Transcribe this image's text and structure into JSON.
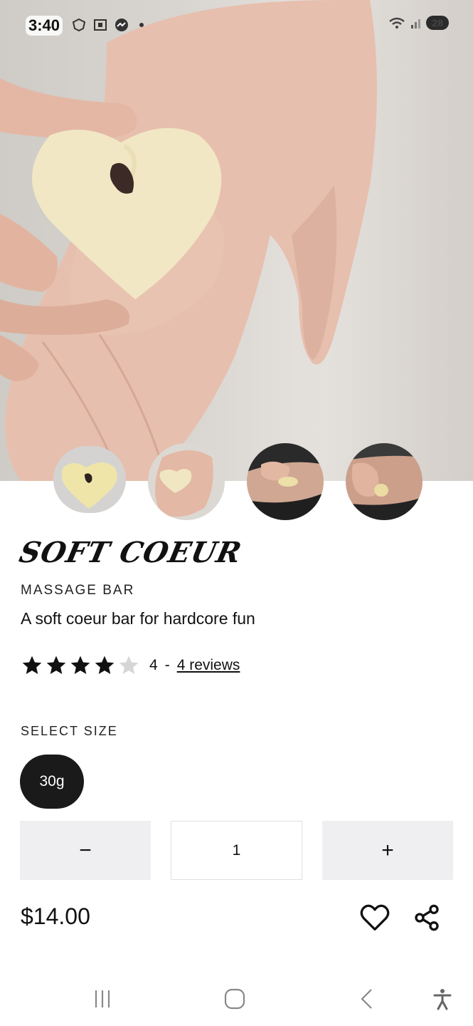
{
  "status_bar": {
    "time": "3:40",
    "battery": "28"
  },
  "product": {
    "name": "SOFT COEUR",
    "category": "MASSAGE BAR",
    "tagline": "A soft coeur bar for hardcore fun",
    "rating": {
      "stars_filled": 4,
      "stars_total": 5,
      "value": "4",
      "separator": "-",
      "reviews_label": "4 reviews"
    },
    "size": {
      "heading": "SELECT SIZE",
      "options": [
        "30g"
      ],
      "selected": "30g"
    },
    "quantity": {
      "minus_label": "−",
      "value": "1",
      "plus_label": "+"
    },
    "price": "$14.00"
  },
  "icons": {
    "favorite": "heart-outline-icon",
    "share": "share-icon"
  },
  "colors": {
    "chip_bg": "#1a1a1a",
    "qty_button_bg": "#efeff1",
    "soap": "#f1e7c4"
  }
}
